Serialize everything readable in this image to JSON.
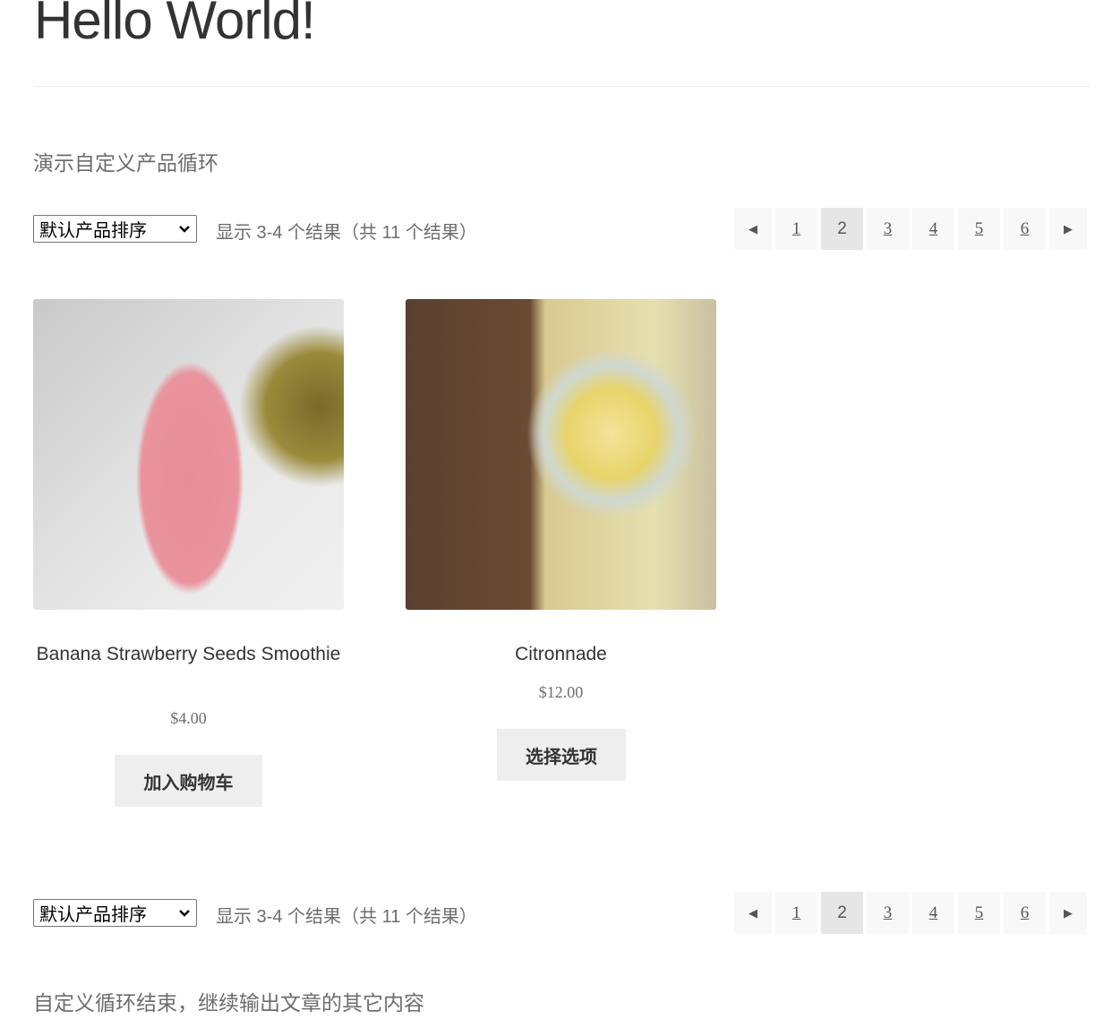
{
  "page": {
    "title": "Hello World!",
    "intro": "演示自定义产品循环",
    "outro": "自定义循环结束，继续输出文章的其它内容"
  },
  "toolbar": {
    "sort_selected": "默认产品排序",
    "result_count": "显示 3-4 个结果（共 11 个结果）"
  },
  "pagination": {
    "pages": [
      "1",
      "2",
      "3",
      "4",
      "5",
      "6"
    ],
    "current": "2",
    "prev_icon": "caret-left-icon",
    "next_icon": "caret-right-icon"
  },
  "products": [
    {
      "title": "Banana Strawberry Seeds Smoothie",
      "price": "$4.00",
      "button": "加入购物车"
    },
    {
      "title": "Citronnade",
      "price": "$12.00",
      "button": "选择选项"
    }
  ]
}
